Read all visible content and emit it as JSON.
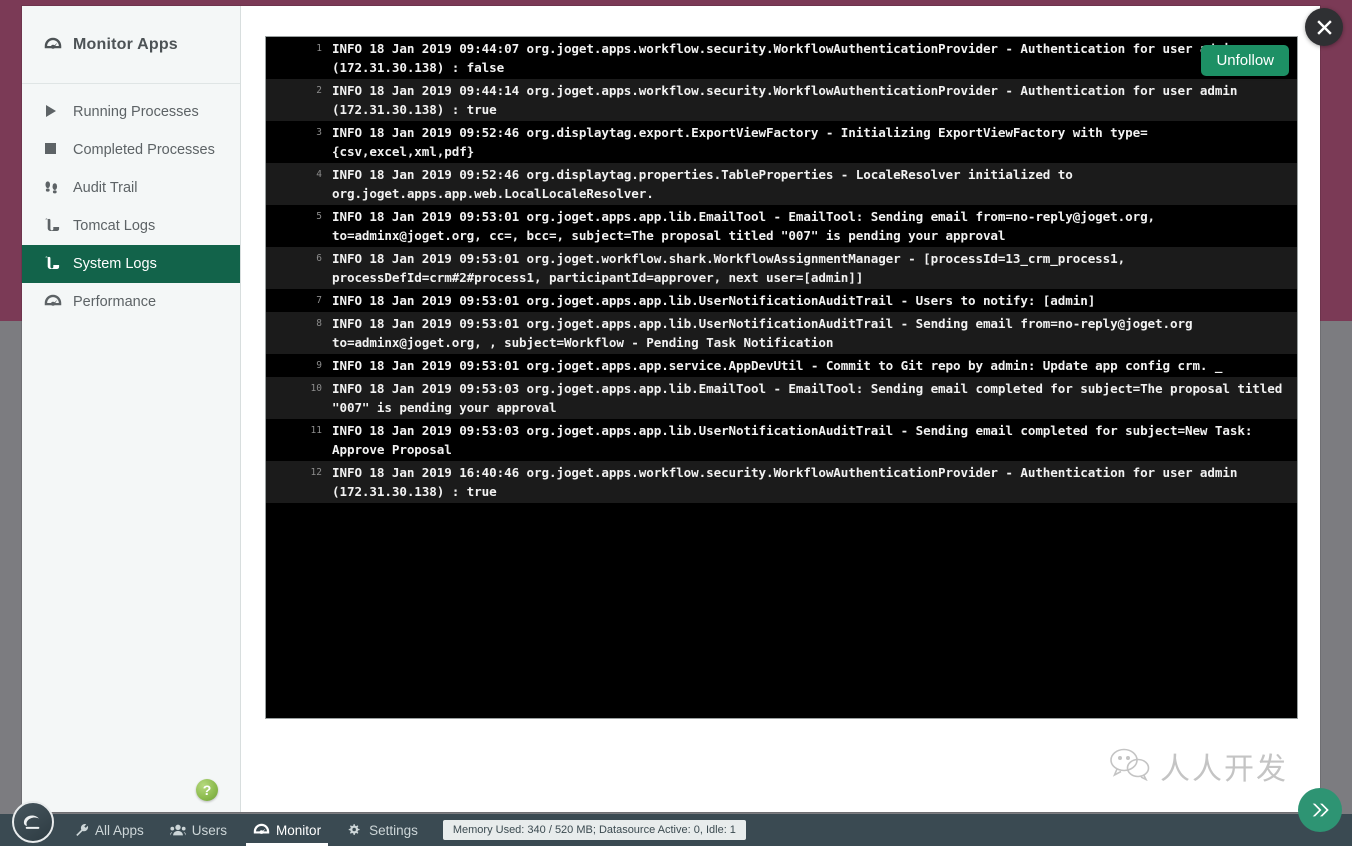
{
  "window": {
    "close_label": "×"
  },
  "sidebar": {
    "header": {
      "title": "Monitor Apps",
      "icon": "speedometer-icon"
    },
    "items": [
      {
        "label": "Running Processes",
        "icon": "play-icon",
        "active": false
      },
      {
        "label": "Completed Processes",
        "icon": "stop-square-icon",
        "active": false
      },
      {
        "label": "Audit Trail",
        "icon": "footprints-icon",
        "active": false
      },
      {
        "label": "Tomcat Logs",
        "icon": "scroll-icon",
        "active": false
      },
      {
        "label": "System Logs",
        "icon": "scroll-icon",
        "active": true
      },
      {
        "label": "Performance",
        "icon": "speedometer-icon",
        "active": false
      }
    ],
    "help_label": "?"
  },
  "main": {
    "unfollow_label": "Unfollow",
    "log_lines": [
      {
        "num": "1",
        "text": "INFO 18 Jan 2019 09:44:07 org.joget.apps.workflow.security.WorkflowAuthenticationProvider - Authentication for user admin (172.31.30.138) : false"
      },
      {
        "num": "2",
        "text": "INFO 18 Jan 2019 09:44:14 org.joget.apps.workflow.security.WorkflowAuthenticationProvider - Authentication for user admin (172.31.30.138) : true"
      },
      {
        "num": "3",
        "text": "INFO 18 Jan 2019 09:52:46 org.displaytag.export.ExportViewFactory - Initializing ExportViewFactory with type={csv,excel,xml,pdf}"
      },
      {
        "num": "4",
        "text": "INFO 18 Jan 2019 09:52:46 org.displaytag.properties.TableProperties - LocaleResolver initialized to org.joget.apps.app.web.LocalLocaleResolver."
      },
      {
        "num": "5",
        "text": "INFO 18 Jan 2019 09:53:01 org.joget.apps.app.lib.EmailTool - EmailTool: Sending email from=no-reply@joget.org, to=adminx@joget.org, cc=, bcc=, subject=The proposal titled \"007\" is pending your approval"
      },
      {
        "num": "6",
        "text": "INFO 18 Jan 2019 09:53:01 org.joget.workflow.shark.WorkflowAssignmentManager - [processId=13_crm_process1, processDefId=crm#2#process1, participantId=approver, next user=[admin]]"
      },
      {
        "num": "7",
        "text": "INFO 18 Jan 2019 09:53:01 org.joget.apps.app.lib.UserNotificationAuditTrail - Users to notify: [admin]"
      },
      {
        "num": "8",
        "text": "INFO 18 Jan 2019 09:53:01 org.joget.apps.app.lib.UserNotificationAuditTrail - Sending email from=no-reply@joget.org to=adminx@joget.org, , subject=Workflow - Pending Task Notification"
      },
      {
        "num": "9",
        "text": "INFO 18 Jan 2019 09:53:01 org.joget.apps.app.service.AppDevUtil - Commit to Git repo by admin: Update app config crm. _"
      },
      {
        "num": "10",
        "text": "INFO 18 Jan 2019 09:53:03 org.joget.apps.app.lib.EmailTool - EmailTool: Sending email completed for subject=The proposal titled \"007\" is pending your approval"
      },
      {
        "num": "11",
        "text": "INFO 18 Jan 2019 09:53:03 org.joget.apps.app.lib.UserNotificationAuditTrail - Sending email completed for subject=New Task: Approve Proposal"
      },
      {
        "num": "12",
        "text": "INFO 18 Jan 2019 16:40:46 org.joget.apps.workflow.security.WorkflowAuthenticationProvider - Authentication for user admin (172.31.30.138) : true"
      }
    ]
  },
  "watermark": {
    "text": "人人开发",
    "url": "https://blog.csdn.net/mikZhang"
  },
  "bottom_bar": {
    "tabs": [
      {
        "label": "All Apps",
        "icon": "wrench-icon",
        "active": false
      },
      {
        "label": "Users",
        "icon": "users-icon",
        "active": false
      },
      {
        "label": "Monitor",
        "icon": "speedometer-icon",
        "active": true
      },
      {
        "label": "Settings",
        "icon": "gears-icon",
        "active": false
      }
    ],
    "status": "Memory Used: 340 / 520 MB; Datasource Active: 0, Idle: 1"
  },
  "colors": {
    "accent_green": "#12634a",
    "button_green": "#1d9065",
    "backdrop_maroon": "#7b3a56",
    "backdrop_grey": "#7c7c80",
    "bottom_bar": "#3a4a52"
  }
}
